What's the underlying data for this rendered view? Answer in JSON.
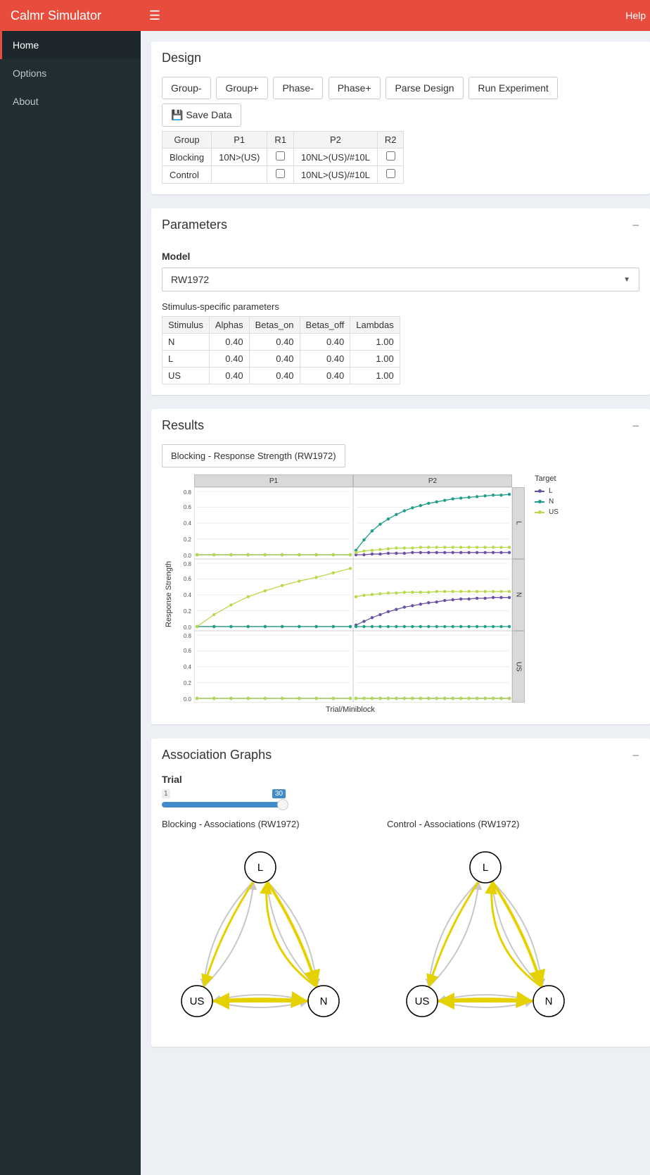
{
  "app": {
    "title": "Calmr Simulator",
    "help": "Help"
  },
  "sidebar": {
    "items": [
      "Home",
      "Options",
      "About"
    ],
    "active": 0
  },
  "design": {
    "title": "Design",
    "buttons": [
      "Group-",
      "Group+",
      "Phase-",
      "Phase+",
      "Parse Design",
      "Run Experiment"
    ],
    "save": "Save Data",
    "headers": [
      "Group",
      "P1",
      "R1",
      "P2",
      "R2"
    ],
    "rows": [
      {
        "group": "Blocking",
        "p1": "10N>(US)",
        "r1": false,
        "p2": "10NL>(US)/#10L",
        "r2": false
      },
      {
        "group": "Control",
        "p1": "",
        "r1": false,
        "p2": "10NL>(US)/#10L",
        "r2": false
      }
    ]
  },
  "parameters": {
    "title": "Parameters",
    "model_label": "Model",
    "model_value": "RW1972",
    "param_note": "Stimulus-specific parameters",
    "headers": [
      "Stimulus",
      "Alphas",
      "Betas_on",
      "Betas_off",
      "Lambdas"
    ],
    "rows": [
      {
        "stim": "N",
        "a": "0.40",
        "bon": "0.40",
        "boff": "0.40",
        "lam": "1.00"
      },
      {
        "stim": "L",
        "a": "0.40",
        "bon": "0.40",
        "boff": "0.40",
        "lam": "1.00"
      },
      {
        "stim": "US",
        "a": "0.40",
        "bon": "0.40",
        "boff": "0.40",
        "lam": "1.00"
      }
    ]
  },
  "results": {
    "title": "Results",
    "selector": "Blocking - Response Strength (RW1972)",
    "ylab": "Response Strength",
    "xlab": "Trial/Miniblock",
    "col_labels": [
      "P1",
      "P2"
    ],
    "row_labels": [
      "L",
      "N",
      "US"
    ],
    "legend_title": "Target",
    "legend": [
      {
        "name": "L",
        "color": "#6a51a3"
      },
      {
        "name": "N",
        "color": "#1f9e89"
      },
      {
        "name": "US",
        "color": "#b8d94a"
      }
    ]
  },
  "assoc": {
    "title": "Association Graphs",
    "slider_label": "Trial",
    "slider_min": "1",
    "slider_val": "30",
    "graphs": [
      {
        "title": "Blocking - Associations (RW1972)",
        "nodes": [
          "L",
          "US",
          "N"
        ]
      },
      {
        "title": "Control - Associations (RW1972)",
        "nodes": [
          "L",
          "US",
          "N"
        ]
      }
    ]
  },
  "chart_data": {
    "type": "line",
    "ylabel": "Response Strength",
    "xlabel": "Trial/Miniblock",
    "ylim": [
      0,
      0.8
    ],
    "columns": [
      "P1",
      "P2"
    ],
    "rows_facet": [
      "L",
      "N",
      "US"
    ],
    "x_P1": [
      1,
      2,
      3,
      4,
      5,
      6,
      7,
      8,
      9,
      10
    ],
    "x_P2": [
      1,
      2,
      3,
      4,
      5,
      6,
      7,
      8,
      9,
      10,
      11,
      12,
      13,
      14,
      15,
      16,
      17,
      18,
      19,
      20
    ],
    "panels": {
      "L_P1": {
        "L": [
          0,
          0,
          0,
          0,
          0,
          0,
          0,
          0,
          0,
          0
        ],
        "N": [
          0,
          0,
          0,
          0,
          0,
          0,
          0,
          0,
          0,
          0
        ],
        "US": [
          0,
          0,
          0,
          0,
          0,
          0,
          0,
          0,
          0,
          0
        ]
      },
      "L_P2": {
        "L": [
          0.0,
          0.0,
          0.01,
          0.01,
          0.02,
          0.02,
          0.02,
          0.03,
          0.03,
          0.03,
          0.03,
          0.03,
          0.03,
          0.03,
          0.03,
          0.03,
          0.03,
          0.03,
          0.03,
          0.03
        ],
        "N": [
          0.06,
          0.2,
          0.32,
          0.41,
          0.48,
          0.54,
          0.59,
          0.63,
          0.66,
          0.69,
          0.71,
          0.73,
          0.75,
          0.76,
          0.77,
          0.78,
          0.79,
          0.8,
          0.8,
          0.81
        ],
        "US": [
          0.03,
          0.05,
          0.06,
          0.07,
          0.08,
          0.09,
          0.09,
          0.09,
          0.1,
          0.1,
          0.1,
          0.1,
          0.1,
          0.1,
          0.1,
          0.1,
          0.1,
          0.1,
          0.1,
          0.1
        ]
      },
      "N_P1": {
        "L": [
          0,
          0,
          0,
          0,
          0,
          0,
          0,
          0,
          0,
          0
        ],
        "N": [
          0,
          0,
          0,
          0,
          0,
          0,
          0,
          0,
          0,
          0
        ],
        "US": [
          0.0,
          0.16,
          0.29,
          0.4,
          0.48,
          0.55,
          0.61,
          0.66,
          0.72,
          0.78
        ]
      },
      "N_P2": {
        "L": [
          0.02,
          0.07,
          0.12,
          0.16,
          0.2,
          0.23,
          0.26,
          0.28,
          0.3,
          0.32,
          0.33,
          0.35,
          0.36,
          0.37,
          0.37,
          0.38,
          0.38,
          0.39,
          0.39,
          0.39
        ],
        "N": [
          0,
          0,
          0,
          0,
          0,
          0,
          0,
          0,
          0,
          0,
          0,
          0,
          0,
          0,
          0,
          0,
          0,
          0,
          0,
          0
        ],
        "US": [
          0.4,
          0.42,
          0.43,
          0.44,
          0.45,
          0.45,
          0.46,
          0.46,
          0.46,
          0.46,
          0.47,
          0.47,
          0.47,
          0.47,
          0.47,
          0.47,
          0.47,
          0.47,
          0.47,
          0.47
        ]
      },
      "US_P1": {
        "L": [
          0,
          0,
          0,
          0,
          0,
          0,
          0,
          0,
          0,
          0
        ],
        "N": [
          0,
          0,
          0,
          0,
          0,
          0,
          0,
          0,
          0,
          0
        ],
        "US": [
          0,
          0,
          0,
          0,
          0,
          0,
          0,
          0,
          0,
          0
        ]
      },
      "US_P2": {
        "L": [
          0,
          0,
          0,
          0,
          0,
          0,
          0,
          0,
          0,
          0,
          0,
          0,
          0,
          0,
          0,
          0,
          0,
          0,
          0,
          0
        ],
        "N": [
          0,
          0,
          0,
          0,
          0,
          0,
          0,
          0,
          0,
          0,
          0,
          0,
          0,
          0,
          0,
          0,
          0,
          0,
          0,
          0
        ],
        "US": [
          0,
          0,
          0,
          0,
          0,
          0,
          0,
          0,
          0,
          0,
          0,
          0,
          0,
          0,
          0,
          0,
          0,
          0,
          0,
          0
        ]
      }
    }
  }
}
